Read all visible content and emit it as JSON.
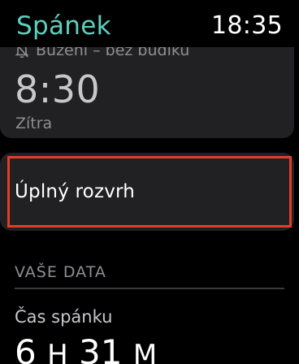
{
  "header": {
    "app_title": "Spánek",
    "clock": "18:35"
  },
  "alarm": {
    "subtitle": "Buzení – bez budíku",
    "subtitle_icon": "bell-slash-icon",
    "time": "8:30",
    "day": "Zítra"
  },
  "schedule": {
    "label": "Úplný rozvrh",
    "highlight_color": "#e23d28"
  },
  "data_section": {
    "header": "VAŠE DATA",
    "sleep_time_label": "Čas spánku",
    "sleep_hours": "6",
    "hours_unit": "H",
    "sleep_minutes": "31",
    "minutes_unit": "M"
  },
  "colors": {
    "accent": "#5ecfbf",
    "card_bg": "#212123",
    "secondary_text": "#8e8e93"
  }
}
